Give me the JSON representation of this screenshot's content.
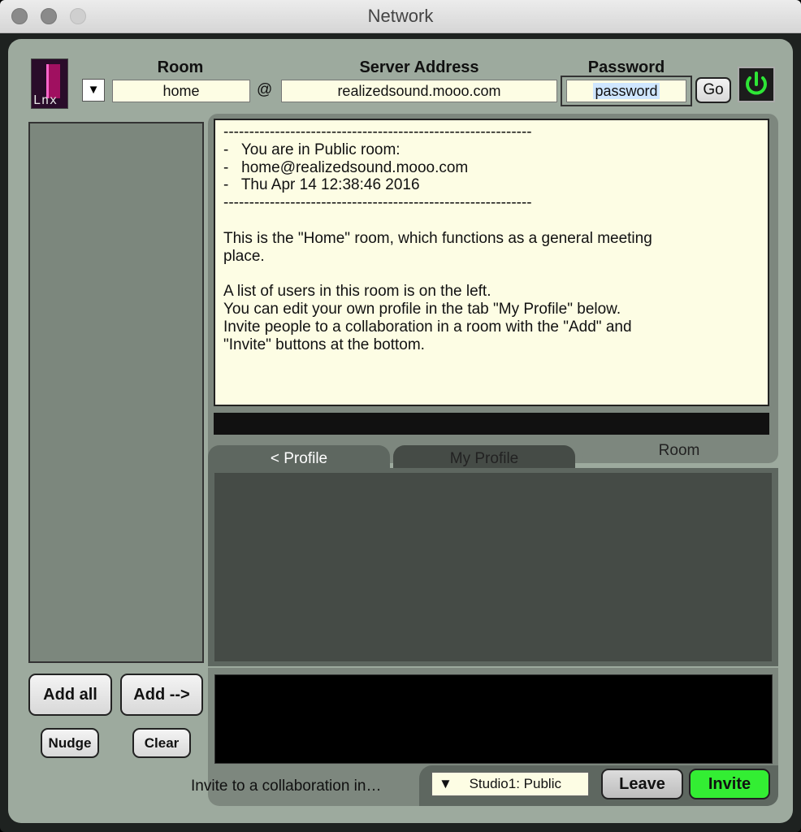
{
  "window": {
    "title": "Network"
  },
  "logo": {
    "text": "Lnx"
  },
  "header": {
    "room_label": "Room",
    "room_value": "home",
    "room_dropdown_glyph": "▼",
    "at_sign": "@",
    "server_label": "Server Address",
    "server_value": "realizedsound.mooo.com",
    "password_label": "Password",
    "password_value": "password",
    "go_label": "Go",
    "power_icon": "power-icon"
  },
  "messages": {
    "lines": [
      "------------------------------------------------------------",
      "-   You are in Public room:",
      "-   home@realizedsound.mooo.com",
      "-   Thu Apr 14 12:38:46 2016",
      "------------------------------------------------------------",
      "",
      "This is the \"Home\" room, which functions as a general meeting",
      "place.",
      "",
      "A list of users in this room is on the left.",
      "You can edit your own profile in the tab \"My Profile\" below.",
      "Invite people to a collaboration in a room with the \"Add\" and",
      "\"Invite\" buttons at the bottom."
    ]
  },
  "tabs": [
    {
      "label": "<  Profile",
      "active": true
    },
    {
      "label": "My Profile",
      "active": false
    },
    {
      "label": "Room",
      "active": false
    }
  ],
  "left_buttons": {
    "add_all": "Add all",
    "add": "Add -->",
    "nudge": "Nudge",
    "clear": "Clear"
  },
  "invite_bar": {
    "label": "Invite to a collaboration in…",
    "studio_glyph": "▼",
    "studio_value": "Studio1: Public",
    "leave": "Leave",
    "invite": "Invite"
  },
  "colors": {
    "panel_bg": "#9daa9e",
    "field_bg": "#fdfde4",
    "power_green": "#2ee636",
    "invite_green": "#33ee33"
  }
}
